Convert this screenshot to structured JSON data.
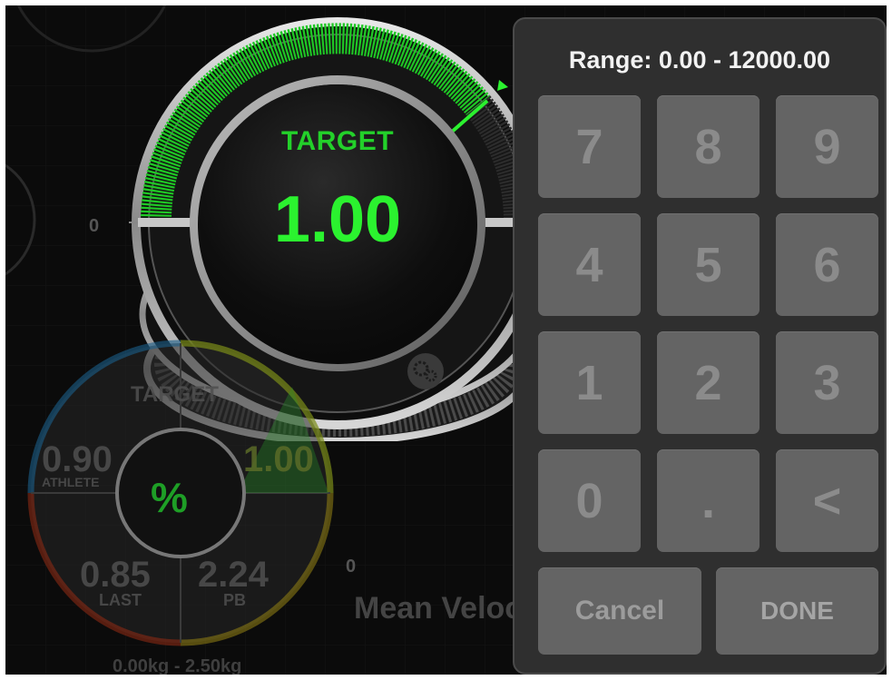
{
  "dial": {
    "target_label": "TARGET",
    "target_value": "1.00",
    "scale_zero": "0"
  },
  "mini_gauge": {
    "target_label": "TARGET",
    "percent_symbol": "%",
    "athlete_value": "0.90",
    "athlete_label": "ATHLETE",
    "target_value": "1.00",
    "last_value": "0.85",
    "last_label": "LAST",
    "pb_value": "2.24",
    "pb_label": "PB"
  },
  "chart_area": {
    "zero_tick": "0",
    "metric_label": "Mean Veloc",
    "weight_range": "0.00kg - 2.50kg"
  },
  "keypad": {
    "range_label": "Range: 0.00 - 12000.00",
    "keys": [
      "7",
      "8",
      "9",
      "4",
      "5",
      "6",
      "1",
      "2",
      "3",
      "0",
      ".",
      "<"
    ],
    "cancel_label": "Cancel",
    "done_label": "DONE"
  },
  "colors": {
    "accent_green": "#2bf22f",
    "keypad_bg": "#2f2f2f",
    "key_bg": "#646464"
  }
}
